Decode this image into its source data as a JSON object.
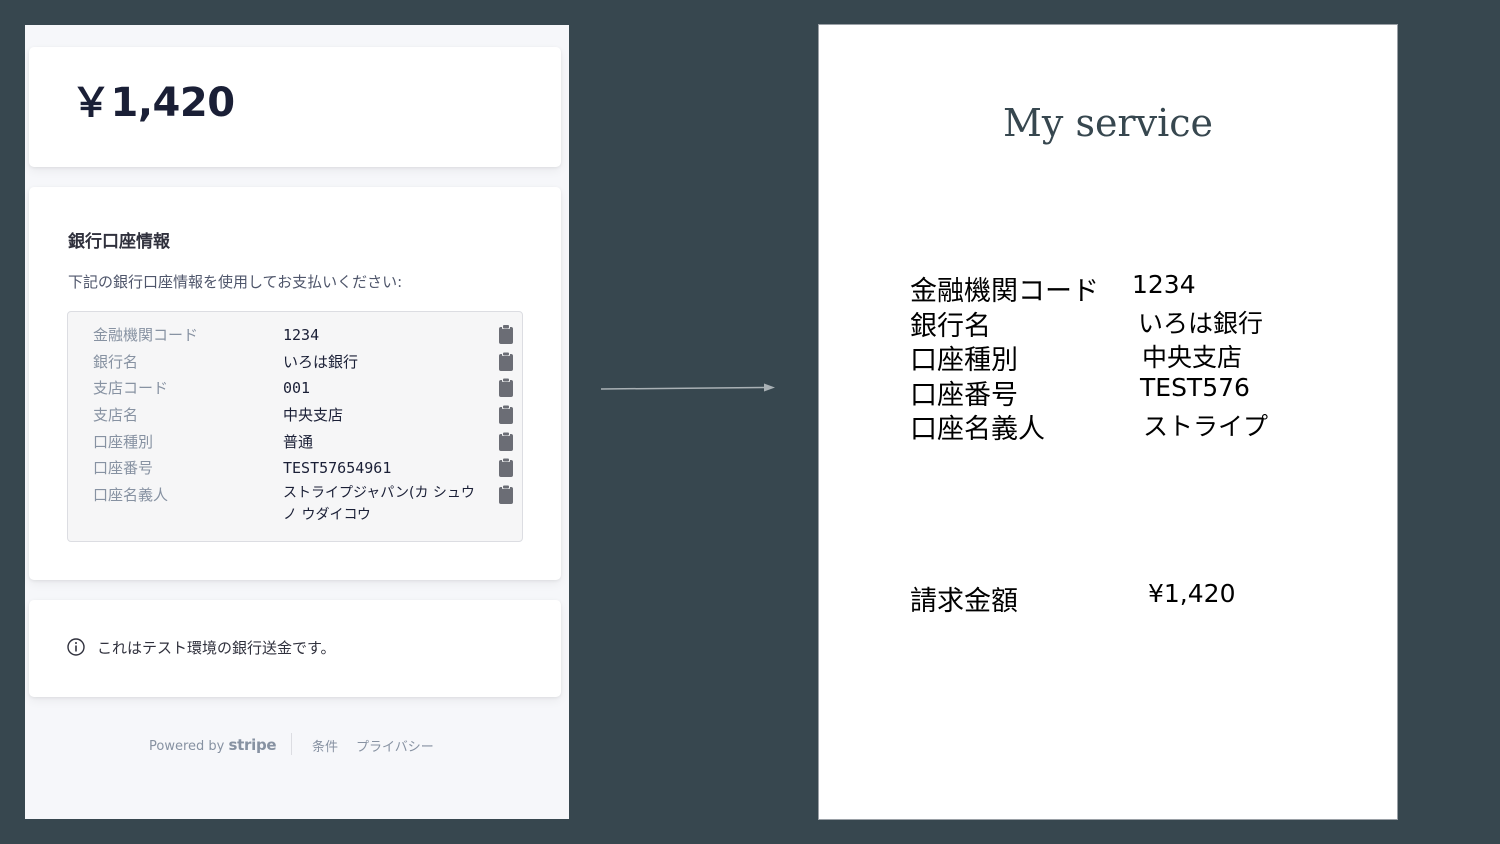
{
  "payment": {
    "amount": "￥1,420",
    "bank_title": "銀行口座情報",
    "bank_description": "下記の銀行口座情報を使用してお支払いください:",
    "bank_info": [
      {
        "label": "金融機関コード",
        "value": "1234"
      },
      {
        "label": "銀行名",
        "value": "いろは銀行"
      },
      {
        "label": "支店コード",
        "value": "001"
      },
      {
        "label": "支店名",
        "value": "中央支店"
      },
      {
        "label": "口座種別",
        "value": "普通"
      },
      {
        "label": "口座番号",
        "value": "TEST57654961"
      },
      {
        "label": "口座名義人",
        "value": "ストライプジャパン(カ シュウノ ウダイコウ"
      }
    ],
    "notice": "これはテスト環境の銀行送金です。",
    "footer": {
      "powered_by": "Powered by",
      "brand": "stripe",
      "terms": "条件",
      "privacy": "プライバシー"
    }
  },
  "invoice": {
    "title": "My service",
    "rows": [
      {
        "label": "金融機関コード",
        "value": "1234"
      },
      {
        "label": "銀行名",
        "value": "いろは銀行"
      },
      {
        "label": "口座種別",
        "value": "中央支店"
      },
      {
        "label": "口座番号",
        "value": "TEST576"
      },
      {
        "label": "口座名義人",
        "value": "ストライプ"
      }
    ],
    "total_label": "請求金額",
    "total_value": "¥1,420"
  },
  "icons": {
    "copy": "clipboard-icon",
    "notice": "info-icon",
    "arrow": "arrow-right-icon"
  },
  "colors": {
    "background": "#37474f",
    "text_primary": "#1a1f36",
    "text_secondary": "#8792a2"
  }
}
